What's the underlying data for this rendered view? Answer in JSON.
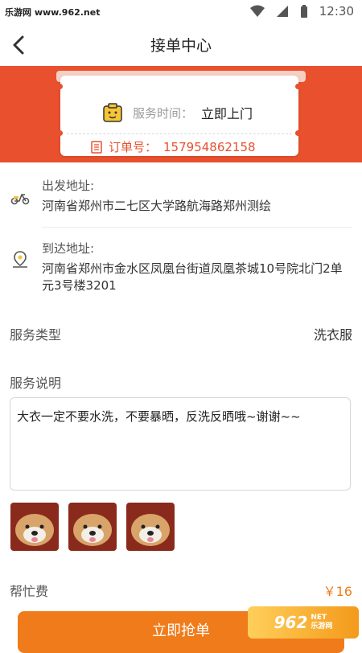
{
  "status_bar": {
    "site": "乐游网 www.962.net",
    "time": "12:30"
  },
  "header": {
    "title": "接单中心"
  },
  "ticket": {
    "service_time_label": "服务时间：",
    "service_time_value": "立即上门",
    "order_label": "订单号：",
    "order_number": "157954862158"
  },
  "departure": {
    "label": "出发地址:",
    "address": "河南省郑州市二七区大学路航海路郑州测绘"
  },
  "arrival": {
    "label": "到达地址:",
    "address": "河南省郑州市金水区凤凰台街道凤凰茶城10号院北门2单元3号楼3201"
  },
  "service_type": {
    "label": "服务类型",
    "value": "洗衣服"
  },
  "service_desc": {
    "label": "服务说明",
    "text": "大衣一定不要水洗，不要暴晒，反洗反晒哦~谢谢~~"
  },
  "fee": {
    "label": "帮忙费",
    "amount": "￥16"
  },
  "action": {
    "grab_label": "立即抢单"
  },
  "watermark": {
    "brand": "962",
    "suffix": "NET",
    "cn": "乐游网"
  },
  "colors": {
    "accent": "#e8502e",
    "button": "#f07b1a"
  }
}
